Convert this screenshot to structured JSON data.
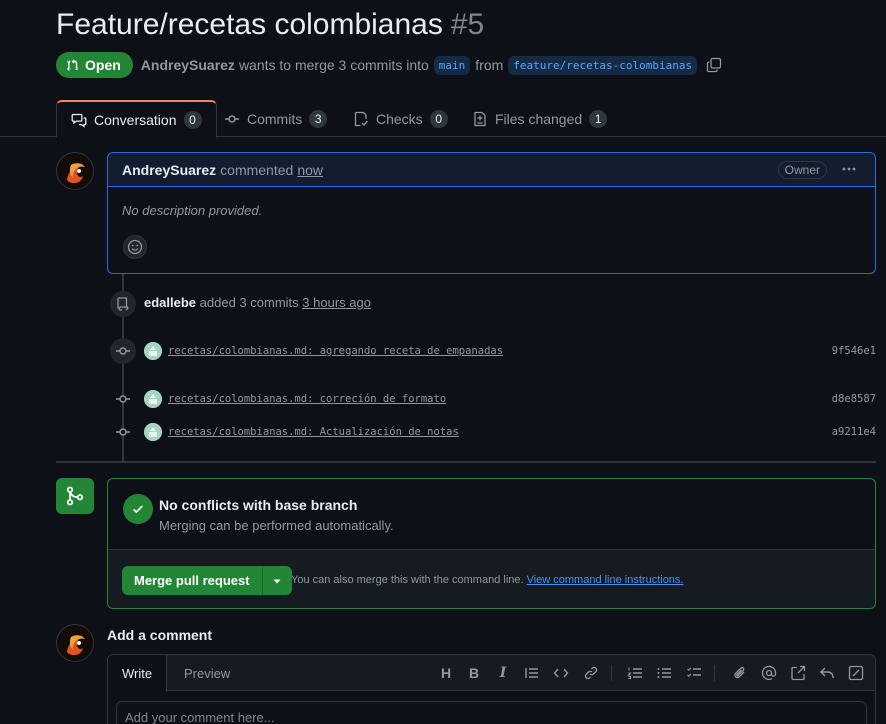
{
  "pr": {
    "title": "Feature/recetas colombianas",
    "number": "#5",
    "state": "Open",
    "author": "AndreySuarez",
    "merge_text": "wants to merge 3 commits into",
    "base_branch": "main",
    "from_text": "from",
    "head_branch": "feature/recetas-colombianas"
  },
  "tabs": [
    {
      "label": "Conversation",
      "count": "0"
    },
    {
      "label": "Commits",
      "count": "3"
    },
    {
      "label": "Checks",
      "count": "0"
    },
    {
      "label": "Files changed",
      "count": "1"
    }
  ],
  "comment": {
    "author": "AndreySuarez",
    "action": "commented",
    "time": "now",
    "role": "Owner",
    "body": "No description provided."
  },
  "push_event": {
    "actor": "edallebe",
    "action": "added 3 commits",
    "time": "3 hours ago"
  },
  "commits": [
    {
      "message": "recetas/colombianas.md: agregando receta de empanadas",
      "sha": "9f546e1"
    },
    {
      "message": "recetas/colombianas.md: correción de formato",
      "sha": "d8e8587"
    },
    {
      "message": "recetas/colombianas.md: Actualización de notas",
      "sha": "a9211e4"
    }
  ],
  "merge": {
    "title": "No conflicts with base branch",
    "subtitle": "Merging can be performed automatically.",
    "button": "Merge pull request",
    "hint": "You can also merge this with the command line.",
    "link": "View command line instructions."
  },
  "add_comment": {
    "title": "Add a comment",
    "tab_write": "Write",
    "tab_preview": "Preview",
    "placeholder": "Add your comment here..."
  },
  "colors": {
    "open_green": "#238636",
    "accent_blue": "#1f6feb",
    "link_blue": "#4493f8",
    "tab_underline": "#f78166"
  }
}
